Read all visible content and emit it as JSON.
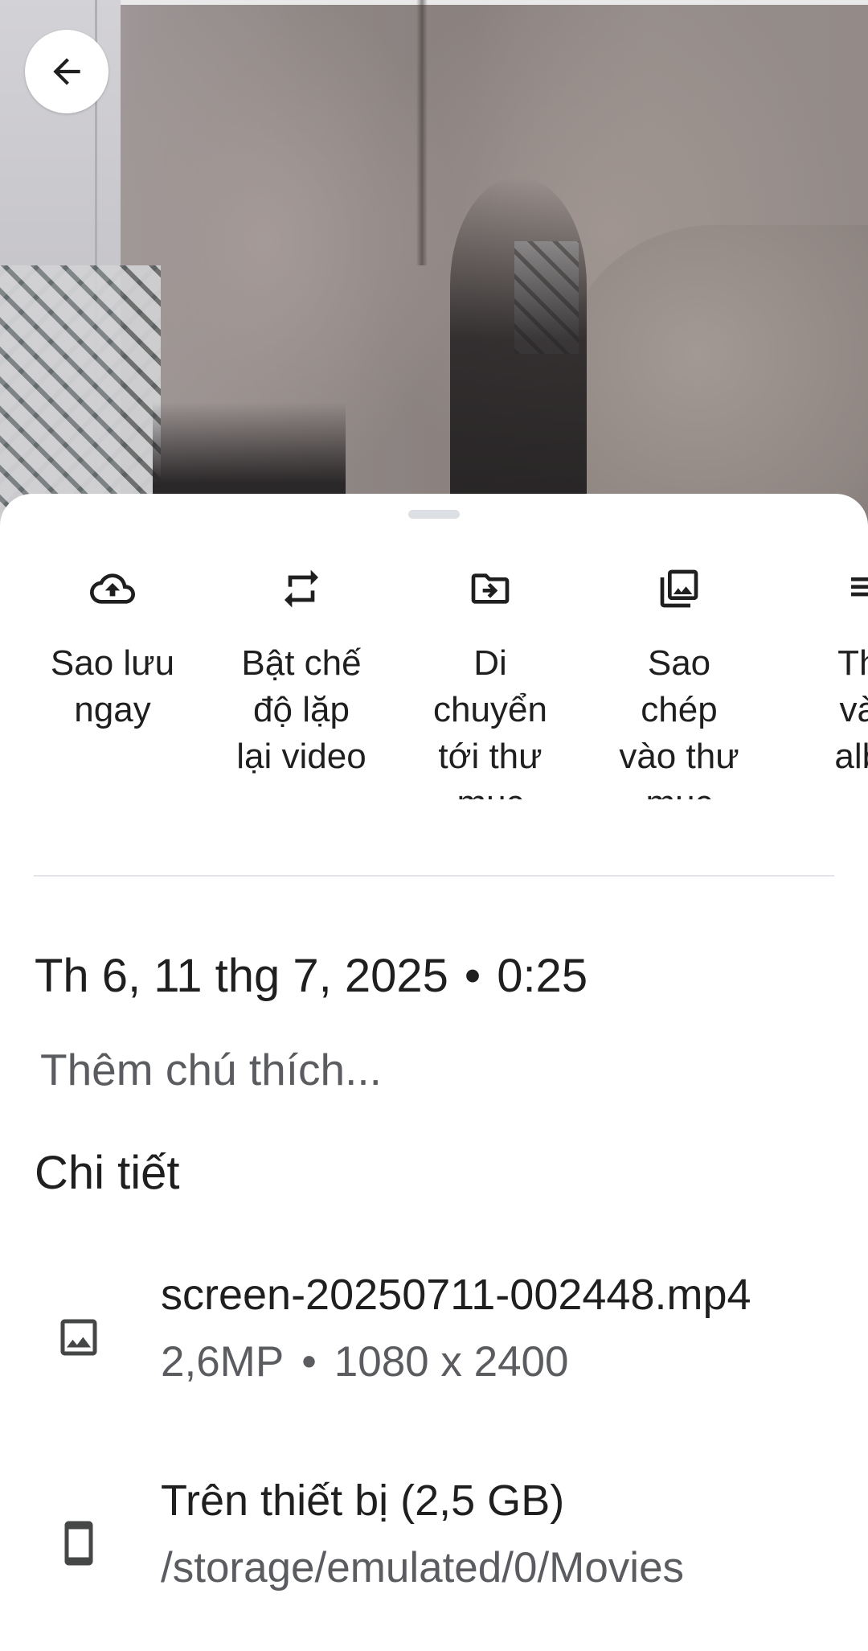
{
  "navigation": {
    "back_icon": "arrow-left-icon"
  },
  "actions": [
    {
      "icon": "cloud-upload-icon",
      "label": "Sao lưu ngay",
      "lines": [
        "Sao lưu",
        "ngay"
      ]
    },
    {
      "icon": "repeat-icon",
      "label": "Bật chế độ lặp lại video",
      "lines": [
        "Bật chế",
        "độ lặp",
        "lại video"
      ]
    },
    {
      "icon": "folder-move-icon",
      "label": "Di chuyển tới thư mục",
      "lines": [
        "Di",
        "chuyển",
        "tới thư",
        "mục"
      ]
    },
    {
      "icon": "photo-library-icon",
      "label": "Sao chép vào thư mục",
      "lines": [
        "Sao",
        "chép",
        "vào thư",
        "mục"
      ]
    },
    {
      "icon": "add-to-album-icon",
      "label": "",
      "lines": [
        "Thê",
        "vào",
        "albu"
      ]
    }
  ],
  "info": {
    "date": "Th 6, 11 thg 7, 2025",
    "time": "0:25",
    "caption_placeholder": "Thêm chú thích..."
  },
  "details": {
    "section_title": "Chi tiết",
    "file": {
      "icon": "image-icon",
      "name": "screen-20250711-002448.mp4",
      "megapixels": "2,6MP",
      "resolution": "1080 x 2400"
    },
    "storage": {
      "icon": "smartphone-icon",
      "title": "Trên thiết bị (2,5 GB)",
      "path": "/storage/emulated/0/Movies"
    }
  }
}
